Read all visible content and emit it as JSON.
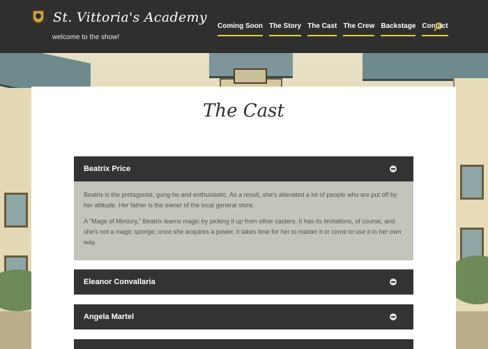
{
  "site": {
    "title": "St. Vittoria's Academy",
    "tagline": "welcome to the show!"
  },
  "nav": {
    "items": [
      "Coming Soon",
      "The Story",
      "The Cast",
      "The Crew",
      "Backstage",
      "Contact"
    ],
    "search_icon": "search-icon",
    "underline_color": "#e1d33a"
  },
  "page": {
    "title": "The Cast"
  },
  "cast": [
    {
      "name": "Beatrix Price",
      "open": true,
      "paragraphs": [
        "Beatrix is the protagonist, gung-ho and enthusiastic. As a result, she's alienated a lot of people who are put off by her attitude. Her father is the owner of the local general store.",
        "A \"Mage of Mimicry,\" Beatrix learns magic by picking it up from other casters. It has its limitations, of course, and she's not a magic sponge; once she acquires a power, it takes time for her to master it or come to use it in her own way."
      ]
    },
    {
      "name": "Eleanor Convallaria",
      "open": false
    },
    {
      "name": "Angela Martel",
      "open": false
    },
    {
      "name": "",
      "open": false
    }
  ],
  "colors": {
    "header_bg": "#2f2f2f",
    "toggle_bg": "#333333",
    "toggle_body_bg": "#c4c4bc",
    "accent": "#e1d33a"
  }
}
